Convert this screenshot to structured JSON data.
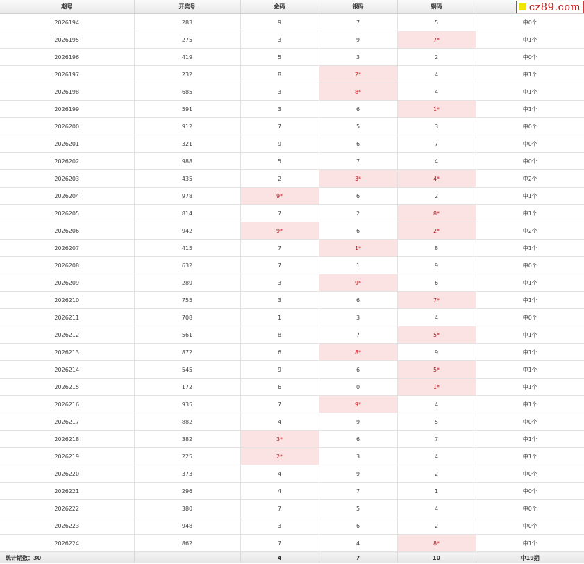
{
  "headers": [
    "期号",
    "开奖号",
    "金码",
    "银码",
    "铜码",
    ""
  ],
  "rows": [
    {
      "issue": "2026194",
      "num": "283",
      "gold": "9",
      "silver": "7",
      "bronze": "5",
      "result": "中0个",
      "hit": []
    },
    {
      "issue": "2026195",
      "num": "275",
      "gold": "3",
      "silver": "9",
      "bronze": "7*",
      "result": "中1个",
      "hit": [
        "bronze"
      ]
    },
    {
      "issue": "2026196",
      "num": "419",
      "gold": "5",
      "silver": "3",
      "bronze": "2",
      "result": "中0个",
      "hit": []
    },
    {
      "issue": "2026197",
      "num": "232",
      "gold": "8",
      "silver": "2*",
      "bronze": "4",
      "result": "中1个",
      "hit": [
        "silver"
      ]
    },
    {
      "issue": "2026198",
      "num": "685",
      "gold": "3",
      "silver": "8*",
      "bronze": "4",
      "result": "中1个",
      "hit": [
        "silver"
      ]
    },
    {
      "issue": "2026199",
      "num": "591",
      "gold": "3",
      "silver": "6",
      "bronze": "1*",
      "result": "中1个",
      "hit": [
        "bronze"
      ]
    },
    {
      "issue": "2026200",
      "num": "912",
      "gold": "7",
      "silver": "5",
      "bronze": "3",
      "result": "中0个",
      "hit": []
    },
    {
      "issue": "2026201",
      "num": "321",
      "gold": "9",
      "silver": "6",
      "bronze": "7",
      "result": "中0个",
      "hit": []
    },
    {
      "issue": "2026202",
      "num": "988",
      "gold": "5",
      "silver": "7",
      "bronze": "4",
      "result": "中0个",
      "hit": []
    },
    {
      "issue": "2026203",
      "num": "435",
      "gold": "2",
      "silver": "3*",
      "bronze": "4*",
      "result": "中2个",
      "hit": [
        "silver",
        "bronze"
      ]
    },
    {
      "issue": "2026204",
      "num": "978",
      "gold": "9*",
      "silver": "6",
      "bronze": "2",
      "result": "中1个",
      "hit": [
        "gold"
      ]
    },
    {
      "issue": "2026205",
      "num": "814",
      "gold": "7",
      "silver": "2",
      "bronze": "8*",
      "result": "中1个",
      "hit": [
        "bronze"
      ]
    },
    {
      "issue": "2026206",
      "num": "942",
      "gold": "9*",
      "silver": "6",
      "bronze": "2*",
      "result": "中2个",
      "hit": [
        "gold",
        "bronze"
      ]
    },
    {
      "issue": "2026207",
      "num": "415",
      "gold": "7",
      "silver": "1*",
      "bronze": "8",
      "result": "中1个",
      "hit": [
        "silver"
      ]
    },
    {
      "issue": "2026208",
      "num": "632",
      "gold": "7",
      "silver": "1",
      "bronze": "9",
      "result": "中0个",
      "hit": []
    },
    {
      "issue": "2026209",
      "num": "289",
      "gold": "3",
      "silver": "9*",
      "bronze": "6",
      "result": "中1个",
      "hit": [
        "silver"
      ]
    },
    {
      "issue": "2026210",
      "num": "755",
      "gold": "3",
      "silver": "6",
      "bronze": "7*",
      "result": "中1个",
      "hit": [
        "bronze"
      ]
    },
    {
      "issue": "2026211",
      "num": "708",
      "gold": "1",
      "silver": "3",
      "bronze": "4",
      "result": "中0个",
      "hit": []
    },
    {
      "issue": "2026212",
      "num": "561",
      "gold": "8",
      "silver": "7",
      "bronze": "5*",
      "result": "中1个",
      "hit": [
        "bronze"
      ]
    },
    {
      "issue": "2026213",
      "num": "872",
      "gold": "6",
      "silver": "8*",
      "bronze": "9",
      "result": "中1个",
      "hit": [
        "silver"
      ]
    },
    {
      "issue": "2026214",
      "num": "545",
      "gold": "9",
      "silver": "6",
      "bronze": "5*",
      "result": "中1个",
      "hit": [
        "bronze"
      ]
    },
    {
      "issue": "2026215",
      "num": "172",
      "gold": "6",
      "silver": "0",
      "bronze": "1*",
      "result": "中1个",
      "hit": [
        "bronze"
      ]
    },
    {
      "issue": "2026216",
      "num": "935",
      "gold": "7",
      "silver": "9*",
      "bronze": "4",
      "result": "中1个",
      "hit": [
        "silver"
      ]
    },
    {
      "issue": "2026217",
      "num": "882",
      "gold": "4",
      "silver": "9",
      "bronze": "5",
      "result": "中0个",
      "hit": []
    },
    {
      "issue": "2026218",
      "num": "382",
      "gold": "3*",
      "silver": "6",
      "bronze": "7",
      "result": "中1个",
      "hit": [
        "gold"
      ]
    },
    {
      "issue": "2026219",
      "num": "225",
      "gold": "2*",
      "silver": "3",
      "bronze": "4",
      "result": "中1个",
      "hit": [
        "gold"
      ]
    },
    {
      "issue": "2026220",
      "num": "373",
      "gold": "4",
      "silver": "9",
      "bronze": "2",
      "result": "中0个",
      "hit": []
    },
    {
      "issue": "2026221",
      "num": "296",
      "gold": "4",
      "silver": "7",
      "bronze": "1",
      "result": "中0个",
      "hit": []
    },
    {
      "issue": "2026222",
      "num": "380",
      "gold": "7",
      "silver": "5",
      "bronze": "4",
      "result": "中0个",
      "hit": []
    },
    {
      "issue": "2026223",
      "num": "948",
      "gold": "3",
      "silver": "6",
      "bronze": "2",
      "result": "中0个",
      "hit": []
    },
    {
      "issue": "2026224",
      "num": "862",
      "gold": "7",
      "silver": "4",
      "bronze": "8*",
      "result": "中1个",
      "hit": [
        "bronze"
      ]
    }
  ],
  "footer": {
    "label": "统计期数：30",
    "num": "",
    "gold": "4",
    "silver": "7",
    "bronze": "10",
    "result": "中19期"
  },
  "watermark": {
    "text": "cz89.com",
    "icon": "yellow-square-icon"
  },
  "colors": {
    "hit_bg": "#fbe3e4",
    "hit_text": "#c0141b",
    "watermark_red": "#c81818",
    "watermark_yellow": "#f2e600"
  }
}
